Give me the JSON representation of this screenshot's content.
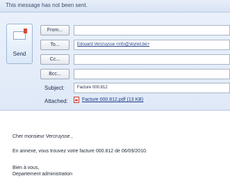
{
  "notice": "This message has not been sent.",
  "send": {
    "label": "Send"
  },
  "buttons": {
    "from": "From...",
    "to": "To...",
    "cc": "Cc...",
    "bcc": "Bcc..."
  },
  "fields": {
    "from_value": "",
    "to_value": "Edouard Vercruysse <info@skynet.be>",
    "cc_value": "",
    "bcc_value": "",
    "subject_label": "Subject:",
    "subject_value": "Facture 000.812",
    "attached_label": "Attached:",
    "attachment": "Facture 000.812.pdf (13 KB)"
  },
  "body": {
    "greeting": "Cher monsieur Vercruysse ,",
    "text": "En annexe, vous trouvez votre facture 000.812 de 06/09/2010.",
    "closing1": "Bien à vous,",
    "closing2": "Departement administration"
  }
}
